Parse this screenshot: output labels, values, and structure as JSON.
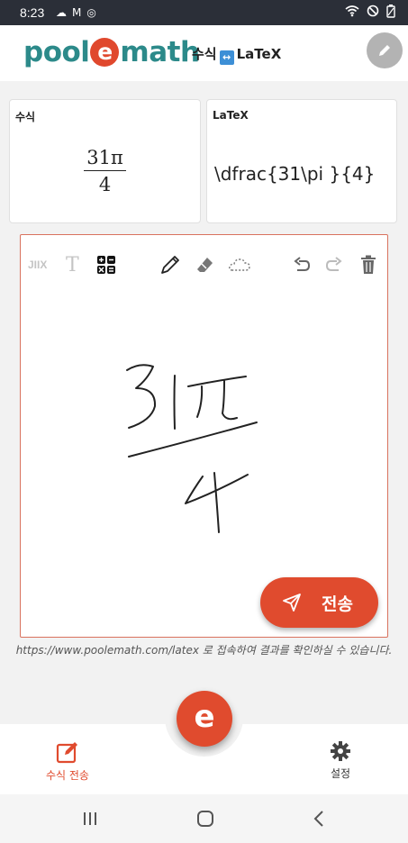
{
  "status_bar": {
    "time": "8:23"
  },
  "header": {
    "logo_pool": "pool",
    "logo_e": "e",
    "logo_math": "math",
    "title_left": "수식",
    "title_right": "LaTeX"
  },
  "formula_card": {
    "label": "수식",
    "numerator": "31π",
    "denominator": "4"
  },
  "latex_card": {
    "label": "LaTeX",
    "value": "\\dfrac{31\\pi }{4}"
  },
  "toolbar": {
    "jiix_label": "JIIX",
    "text_label": "T",
    "icons": [
      "math-mode-icon",
      "pen-icon",
      "eraser-icon",
      "lasso-icon",
      "undo-icon",
      "redo-icon",
      "trash-icon"
    ]
  },
  "send_button": {
    "label": "전송"
  },
  "hint": {
    "text": "https://www.poolemath.com/latex 로 접속하여 결과를 확인하실 수 있습니다."
  },
  "bottom_nav": {
    "send_label": "수식 전송",
    "center_fab": "e",
    "settings_label": "설정"
  },
  "colors": {
    "accent": "#e04b2e",
    "brand_teal": "#2c8a8a",
    "status_bar": "#2b2f38"
  }
}
